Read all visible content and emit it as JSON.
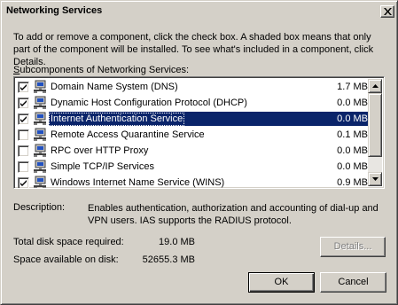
{
  "window": {
    "title": "Networking Services"
  },
  "intro_text": "To add or remove a component, click the check box. A shaded box means that only part of the component will be installed. To see what's included in a component, click Details.",
  "subcomponents_label_first": "S",
  "subcomponents_label_rest": "ubcomponents of Networking Services:",
  "components": [
    {
      "name": "Domain Name System (DNS)",
      "size": "1.7 MB",
      "checked": true
    },
    {
      "name": "Dynamic Host Configuration Protocol (DHCP)",
      "size": "0.0 MB",
      "checked": true
    },
    {
      "name": "Internet Authentication Service",
      "size": "0.0 MB",
      "checked": true,
      "selected": true
    },
    {
      "name": "Remote Access Quarantine Service",
      "size": "0.1 MB",
      "checked": false
    },
    {
      "name": "RPC over HTTP Proxy",
      "size": "0.0 MB",
      "checked": false
    },
    {
      "name": "Simple TCP/IP Services",
      "size": "0.0 MB",
      "checked": false
    },
    {
      "name": "Windows Internet Name Service (WINS)",
      "size": "0.9 MB",
      "checked": true
    }
  ],
  "description": {
    "label": "Description:",
    "text": "Enables authentication, authorization and accounting of dial-up and VPN users. IAS supports the RADIUS protocol."
  },
  "disk": {
    "required_label": "Total disk space required:",
    "required_value": "19.0 MB",
    "available_label": "Space available on disk:",
    "available_value": "52655.3 MB"
  },
  "buttons": {
    "details": "Details...",
    "ok": "OK",
    "cancel": "Cancel"
  },
  "colors": {
    "dialog_face": "#d4d0c8",
    "selection": "#0a246a"
  },
  "icons": {
    "component": "network-services-icon",
    "close": "close-icon",
    "checkbox_mark": "checkmark-icon"
  }
}
